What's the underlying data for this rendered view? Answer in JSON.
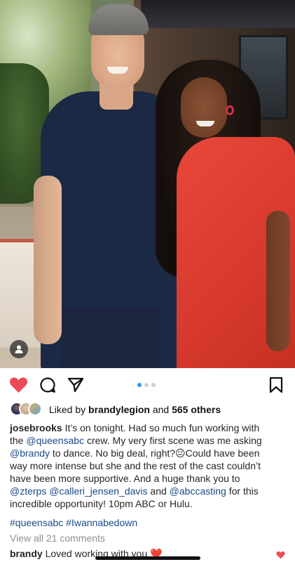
{
  "post": {
    "photo": {
      "alt_semantic": "two-people-posing-photo"
    },
    "actions": {
      "like_icon": "heart-filled-icon",
      "comment_icon": "comment-bubble-icon",
      "share_icon": "paper-plane-icon",
      "save_icon": "bookmark-icon",
      "like_color": "#ed4956",
      "carousel_active_color": "#3897f0",
      "carousel_pages": 3,
      "carousel_active_index": 0
    },
    "likes": {
      "prefix": "Liked by",
      "user": "brandylegion",
      "conjunction": "and",
      "others": "565 others"
    },
    "caption": {
      "username": "josebrooks",
      "line1": "It’s on tonight. Had so much fun working with",
      "the": "the",
      "mention_queens": "@queensabc",
      "after_queens": "crew. My very first scene was me asking",
      "mention_brandy": "@brandy",
      "after_brandy": "to dance. No big deal, right?",
      "emoji": "😐",
      "after_emoji": "Could have been",
      "line4": "way more intense but she and the rest of the cast couldn’t",
      "line5": "have been more supportive. And a huge thank you to",
      "mention_zterps": "@zterps",
      "mention_calleri": "@calleri_jensen_davis",
      "and": "and",
      "mention_abccasting": "@abccasting",
      "after_abc": "for this",
      "line7": "incredible opportunity! 10pm ABC or Hulu."
    },
    "hashtags": "#queensabc #Iwannabedown",
    "view_comments": "View all 21 comments",
    "comment": {
      "username": "brandy",
      "text": "Loved working with you",
      "emoji": "❤️"
    }
  }
}
